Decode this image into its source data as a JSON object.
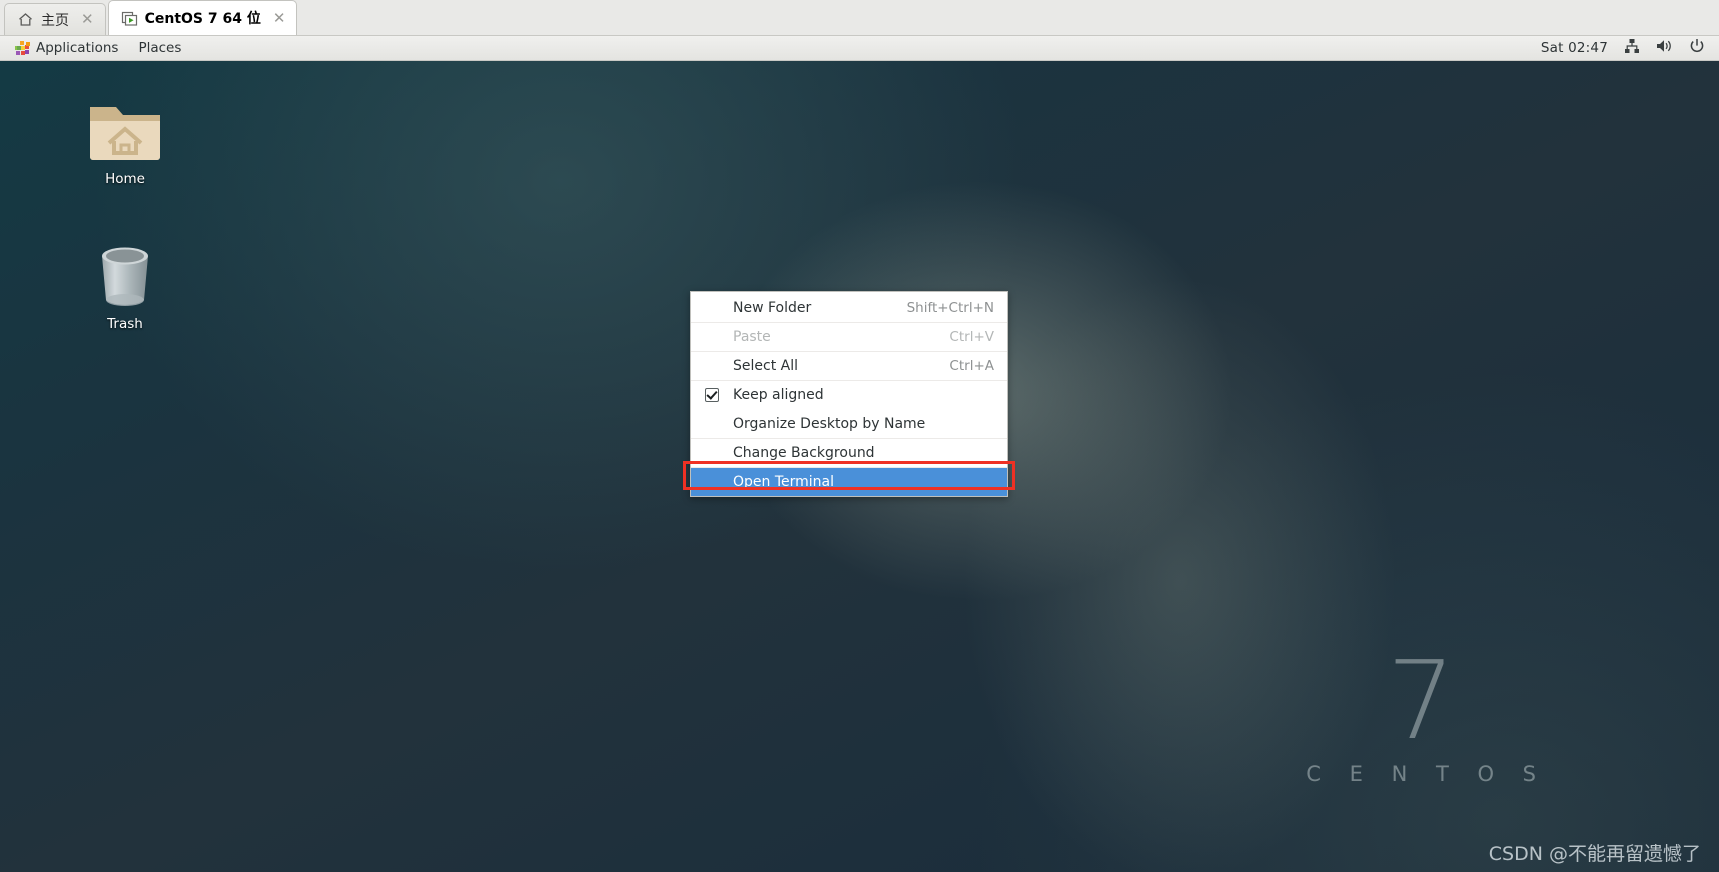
{
  "tabs": [
    {
      "label": "主页",
      "icon": "home-icon",
      "active": false,
      "close": "✕"
    },
    {
      "label": "CentOS 7 64 位",
      "icon": "vm-play-icon",
      "active": true,
      "close": "✕"
    }
  ],
  "panel": {
    "applications_label": "Applications",
    "places_label": "Places",
    "clock": "Sat 02:47",
    "icons": {
      "applications": "applications-grid-icon",
      "network": "network-wired-icon",
      "volume": "volume-icon",
      "power": "power-icon"
    }
  },
  "desktop": {
    "icons": [
      {
        "label": "Home",
        "icon": "home-folder-icon"
      },
      {
        "label": "Trash",
        "icon": "trash-can-icon"
      }
    ],
    "watermark": {
      "version": "7",
      "name": "C E N T O S",
      "credit": "CSDN @不能再留遗憾了"
    }
  },
  "context_menu": {
    "items": [
      {
        "label": "New Folder",
        "accel": "Shift+Ctrl+N",
        "state": "normal",
        "checkbox": false
      },
      {
        "label": "Paste",
        "accel": "Ctrl+V",
        "state": "disabled",
        "checkbox": false
      },
      {
        "label": "Select All",
        "accel": "Ctrl+A",
        "state": "normal",
        "checkbox": false
      },
      {
        "label": "Keep aligned",
        "accel": "",
        "state": "normal",
        "checkbox": true,
        "checked": true
      },
      {
        "label": "Organize Desktop by Name",
        "accel": "",
        "state": "normal",
        "checkbox": false
      },
      {
        "label": "Change Background",
        "accel": "",
        "state": "normal",
        "checkbox": false
      },
      {
        "label": "Open Terminal",
        "accel": "",
        "state": "selected",
        "checkbox": false
      }
    ]
  },
  "colors": {
    "menu_highlight": "#4a90d9",
    "annotation_red": "#ef3124",
    "desktop_base": "#1b333f",
    "panel_bg": "#ececea"
  }
}
